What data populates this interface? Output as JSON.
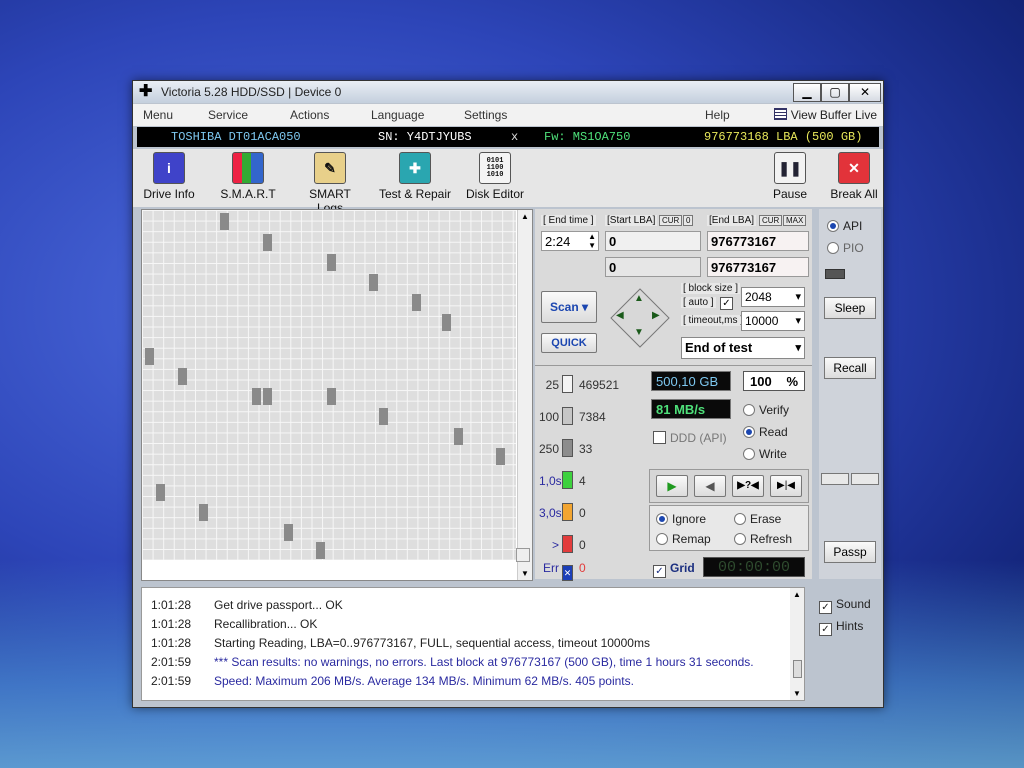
{
  "window": {
    "title": "Victoria 5.28 HDD/SSD | Device 0"
  },
  "menu": {
    "items": [
      "Menu",
      "Service",
      "Actions",
      "Language",
      "Settings",
      "Help"
    ],
    "view_buffer": "View Buffer Live"
  },
  "drive": {
    "model": "TOSHIBA DT01ACA050",
    "serial": "SN: Y4DTJYUBS",
    "x_mark": "x",
    "firmware": "Fw: MS1OA750",
    "capacity": "976773168 LBA (500 GB)"
  },
  "toolbar": {
    "drive_info": "Drive Info",
    "smart": "S.M.A.R.T",
    "smart_logs": "SMART Logs",
    "test_repair": "Test & Repair",
    "disk_editor": "Disk Editor",
    "pause": "Pause",
    "break_all": "Break All"
  },
  "scan": {
    "end_time_label": "[ End time ]",
    "end_time": "2:24",
    "start_lba_label": "[Start LBA]",
    "cur_label": "CUR",
    "zero_label": "0",
    "end_lba_label": "[End LBA]",
    "max_label": "MAX",
    "start_lba": "0",
    "end_lba": "976773167",
    "start_lba2": "0",
    "end_lba2": "976773167",
    "scan_button": "Scan",
    "quick_button": "QUICK",
    "block_size_label": "[ block size ]",
    "auto_label": "[ auto ]",
    "block_size": "2048",
    "timeout_label": "[ timeout,ms ]",
    "timeout": "10000",
    "end_action": "End of test",
    "size_readout": "500,10 GB",
    "percent": "100",
    "percent_sign": "%",
    "speed_readout": "81 MB/s",
    "ddd_label": "DDD (API)",
    "mode_verify": "Verify",
    "mode_read": "Read",
    "mode_write": "Write",
    "act_ignore": "Ignore",
    "act_erase": "Erase",
    "act_remap": "Remap",
    "act_refresh": "Refresh",
    "grid_label": "Grid",
    "timer": "00:00:00"
  },
  "legend": [
    {
      "label": "25",
      "count": "469521",
      "color": "#f4f4f4"
    },
    {
      "label": "100",
      "count": "7384",
      "color": "#c6c6c6"
    },
    {
      "label": "250",
      "count": "33",
      "color": "#8c8c8c"
    },
    {
      "label": "1,0s",
      "count": "4",
      "color": "#3ed13e"
    },
    {
      "label": "3,0s",
      "count": "0",
      "color": "#f2a531"
    },
    {
      "label": ">",
      "count": "0",
      "color": "#e23c3c"
    },
    {
      "label": "Err",
      "count": "0",
      "color": "#1b3fb8"
    }
  ],
  "side": {
    "api": "API",
    "pio": "PIO",
    "sleep": "Sleep",
    "recall": "Recall",
    "passp": "Passp"
  },
  "log": [
    {
      "time": "1:01:28",
      "msg": "Get drive passport... OK",
      "color": "#222"
    },
    {
      "time": "1:01:28",
      "msg": "Recallibration... OK",
      "color": "#222"
    },
    {
      "time": "1:01:28",
      "msg": "Starting Reading, LBA=0..976773167, FULL, sequential access, timeout 10000ms",
      "color": "#222"
    },
    {
      "time": "2:01:59",
      "msg": "*** Scan results: no warnings, no errors. Last block at 976773167 (500 GB), time 1 hours 31 seconds.",
      "color": "#2a2aa0"
    },
    {
      "time": "2:01:59",
      "msg": "Speed: Maximum 206 MB/s. Average 134 MB/s. Minimum 62 MB/s. 405 points.",
      "color": "#2a2aa0"
    }
  ],
  "options": {
    "sound": "Sound",
    "hints": "Hints"
  },
  "colors": {
    "accent": "#1b46b0",
    "drive_model": "#7ec8f0",
    "firmware": "#4ee07a",
    "capacity": "#e8e85a"
  }
}
